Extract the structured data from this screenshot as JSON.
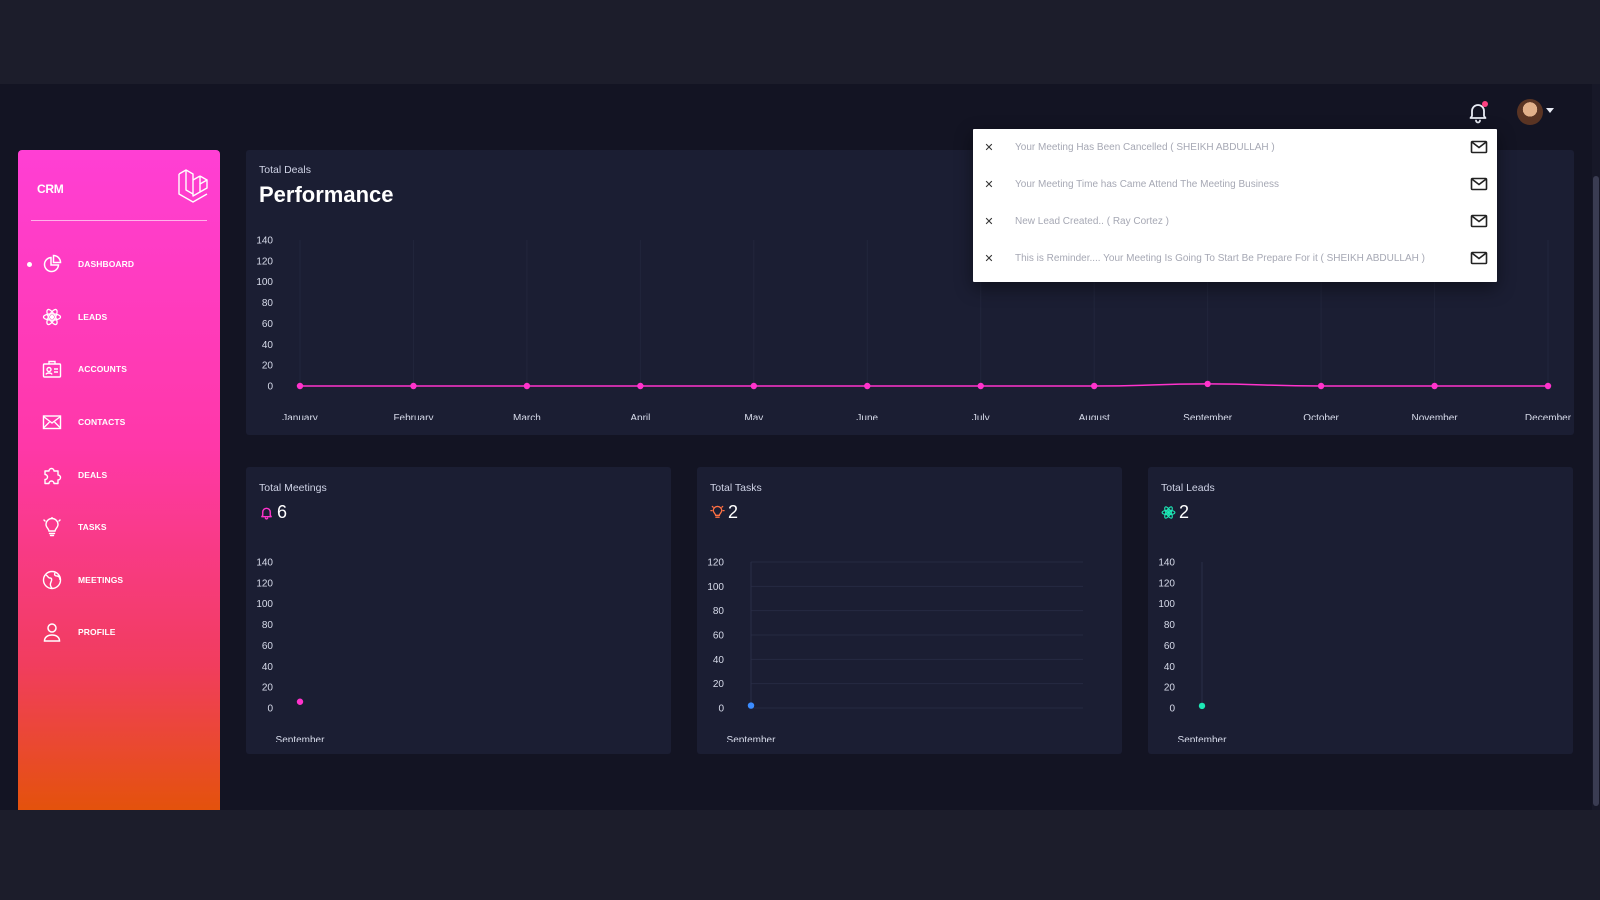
{
  "app": {
    "name": "CRM"
  },
  "header": {
    "bell_icon": "bell-icon",
    "has_unread": true,
    "user_avatar": "user-avatar"
  },
  "sidebar": {
    "items": [
      {
        "label": "DASHBOARD",
        "icon": "pie-chart-icon",
        "active": true
      },
      {
        "label": "LEADS",
        "icon": "atom-icon"
      },
      {
        "label": "ACCOUNTS",
        "icon": "id-card-icon"
      },
      {
        "label": "CONTACTS",
        "icon": "mail-icon"
      },
      {
        "label": "DEALS",
        "icon": "puzzle-icon"
      },
      {
        "label": "TASKS",
        "icon": "lightbulb-icon"
      },
      {
        "label": "MEETINGS",
        "icon": "globe-icon"
      },
      {
        "label": "PROFILE",
        "icon": "user-icon"
      }
    ]
  },
  "notifications": [
    {
      "text": "Your Meeting Has Been Cancelled ( SHEIKH ABDULLAH )"
    },
    {
      "text": "Your Meeting Time has Came Attend The Meeting Business"
    },
    {
      "text": "New Lead Created.. ( Ray Cortez )"
    },
    {
      "text": "This is Reminder.... Your Meeting Is Going To Start Be Prepare For it ( SHEIKH ABDULLAH )"
    }
  ],
  "performance": {
    "subtitle": "Total Deals",
    "title": "Performance"
  },
  "meetings": {
    "label": "Total Meetings",
    "value": "6",
    "icon": "bell-icon"
  },
  "tasks": {
    "label": "Total Tasks",
    "value": "2",
    "icon": "lightbulb-icon"
  },
  "leads": {
    "label": "Total Leads",
    "value": "2",
    "icon": "atom-icon"
  },
  "colors": {
    "accent": "#ff33cc",
    "tasks": "#3b8cff",
    "leads": "#1de9b6",
    "card": "#1b1e33",
    "bg": "#131423"
  },
  "chart_data": [
    {
      "type": "line",
      "categories": [
        "January",
        "February",
        "March",
        "April",
        "May",
        "June",
        "July",
        "August",
        "September",
        "October",
        "November",
        "December"
      ],
      "series": [
        {
          "values": [
            0,
            0,
            0,
            0,
            0,
            0,
            0,
            0,
            2,
            0,
            0,
            0
          ]
        }
      ],
      "ylim": [
        0,
        140
      ],
      "yticks": [
        0,
        20,
        40,
        60,
        80,
        100,
        120,
        140
      ],
      "grid": "vertical"
    },
    {
      "type": "scatter",
      "categories": [
        "September"
      ],
      "series": [
        {
          "values": [
            6
          ]
        }
      ],
      "ylim": [
        0,
        140
      ],
      "yticks": [
        0,
        20,
        40,
        60,
        80,
        100,
        120,
        140
      ]
    },
    {
      "type": "scatter",
      "categories": [
        "September"
      ],
      "series": [
        {
          "values": [
            2
          ]
        }
      ],
      "ylim": [
        0,
        120
      ],
      "yticks": [
        0,
        20,
        40,
        60,
        80,
        100,
        120
      ]
    },
    {
      "type": "scatter",
      "categories": [
        "September"
      ],
      "series": [
        {
          "values": [
            2
          ]
        }
      ],
      "ylim": [
        0,
        140
      ],
      "yticks": [
        0,
        20,
        40,
        60,
        80,
        100,
        120,
        140
      ]
    }
  ]
}
